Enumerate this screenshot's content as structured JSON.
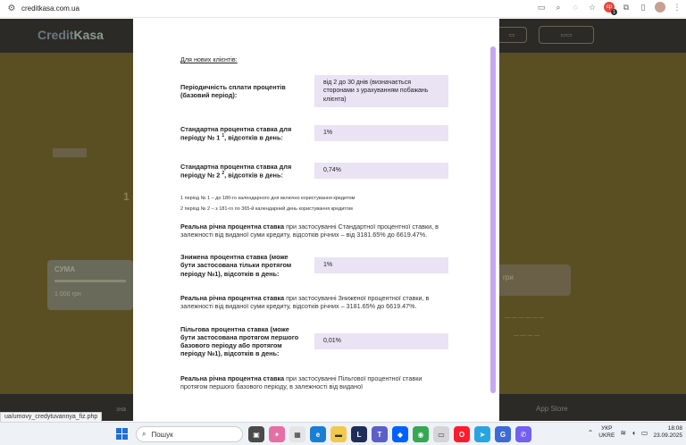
{
  "browser": {
    "url": "creditkasa.com.ua",
    "status_link": "ua/umovy_credytuvannya_fiz.php"
  },
  "background": {
    "logo_credit": "Credit",
    "logo_kasa": "Kasa",
    "card_label": "СУМА",
    "card_value": "1 000 грн",
    "right_btn": "гри",
    "app_label": "App Store",
    "bottom_label": "зна"
  },
  "modal": {
    "section_title": "Для нових клієнтів:",
    "rows": [
      {
        "label": "Періодичність сплати процентів (базовий період):",
        "value": "від 2 до 30 днів (визначається сторонами з урахуванням побажань клієнта)"
      },
      {
        "label": "Стандартна процентна ставка для періоду № 1 1, відсотків в день:",
        "value": "1%"
      },
      {
        "label": "Стандартна процентна ставка для періоду № 2 2, відсотків в день:",
        "value": "0,74%"
      }
    ],
    "footnotes": [
      "1 період № 1 – до 180-го календарного дня включно користування кредитом",
      "2 період № 2 – з 181-го по 365-й календарний день користування кредитом"
    ],
    "para1_bold": "Реальна річна процентна ставка",
    "para1_rest": " при застосуванні Стандартної процентної ставки, в залежності від виданої суми кредиту, відсотків річних – від 3181.65% до 6619.47%.",
    "row_reduced_label": "Знижена процентна ставка (може бути застосована тільки протягом періоду №1), відсотків в день:",
    "row_reduced_value": "1%",
    "para2_bold": "Реальна річна процентна ставка",
    "para2_rest": " при застосуванні Зниженої процентної ставки, в залежності від виданої суми кредиту, відсотків річних – 3181.65% до 6619.47%.",
    "row_pref_label": "Пільгова процентна ставка (може бути застосована протягом першого базового періоду або протягом періоду №1), відсотків в день:",
    "row_pref_value": "0,01%",
    "para3_bold": "Реальна річна процентна ставка",
    "para3_rest": " при застосуванні Пільгової процентної ставки протягом першого базового періоду, в залежності від виданої"
  },
  "taskbar": {
    "search_placeholder": "Пошук",
    "lang_top": "УКР",
    "lang_bottom": "UKRE",
    "time": "18:08",
    "date": "23.09.2025"
  }
}
